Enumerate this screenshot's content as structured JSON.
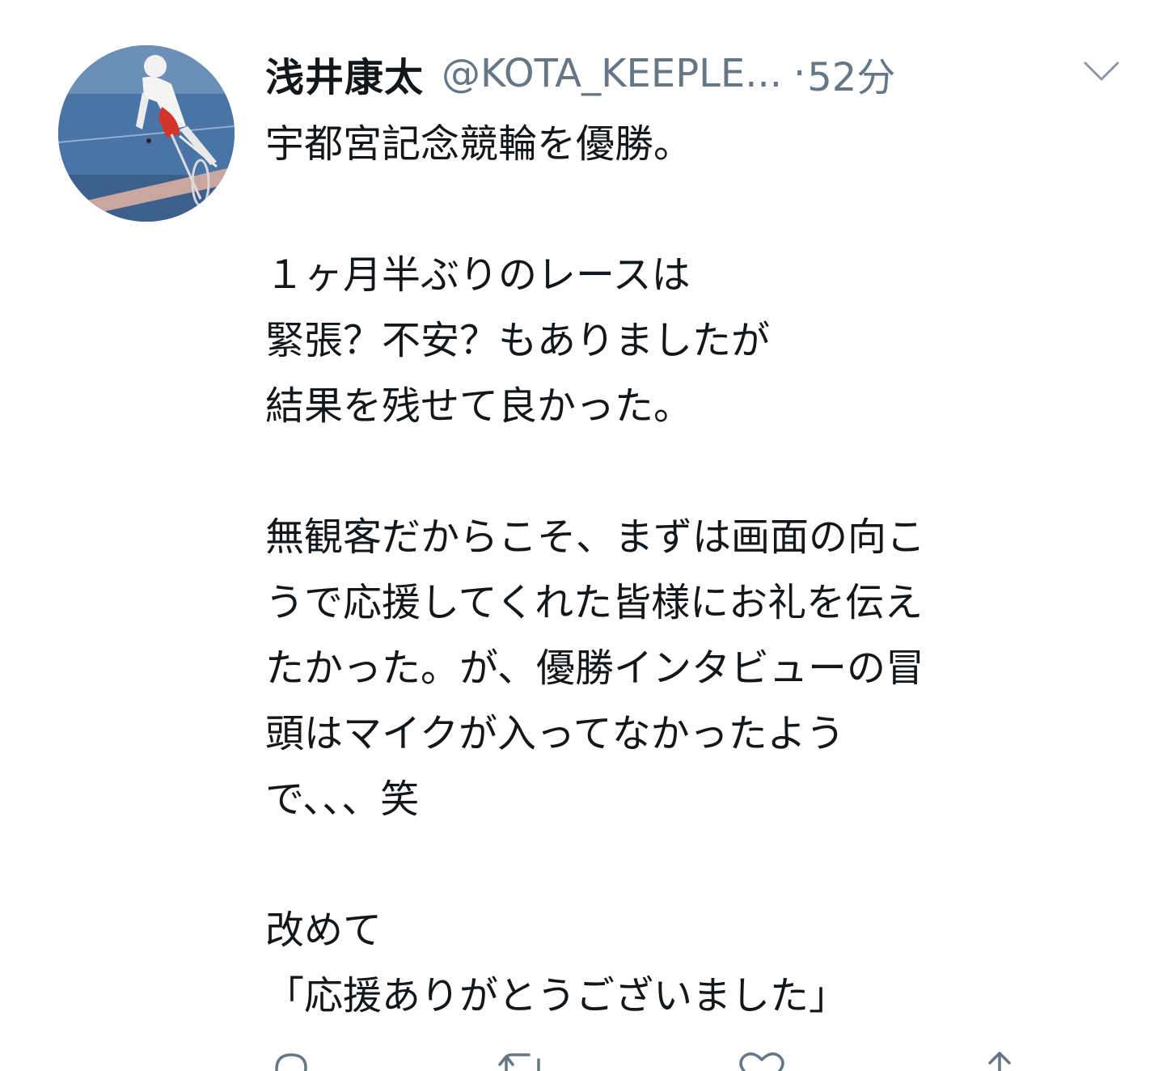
{
  "tweet": {
    "display_name": "浅井康太",
    "handle": "@KOTA_KEEPLE...",
    "separator": "·",
    "time": "52分",
    "body": {
      "line1": "宇都宮記念競輪を優勝。",
      "line2": "１ヶ月半ぶりのレースは",
      "line3": "緊張？不安？もありましたが",
      "line4": "結果を残せて良かった。",
      "line5": "無観客だからこそ、まずは画面の向こ",
      "line6": "うで応援してくれた皆様にお礼を伝え",
      "line7": "たかった。が、優勝インタビューの冒",
      "line8": "頭はマイクが入ってなかったよう",
      "line9": "で、、、笑",
      "line10": "改めて",
      "line11": "「応援ありがとうございました」"
    }
  },
  "icons": {
    "avatar": "avatar-cyclist-photo",
    "more": "chevron-down-icon",
    "reply": "reply-icon",
    "retweet": "retweet-icon",
    "like": "heart-icon",
    "share": "share-icon"
  },
  "colors": {
    "text": "#14171a",
    "secondary": "#657786",
    "background": "#ffffff"
  }
}
